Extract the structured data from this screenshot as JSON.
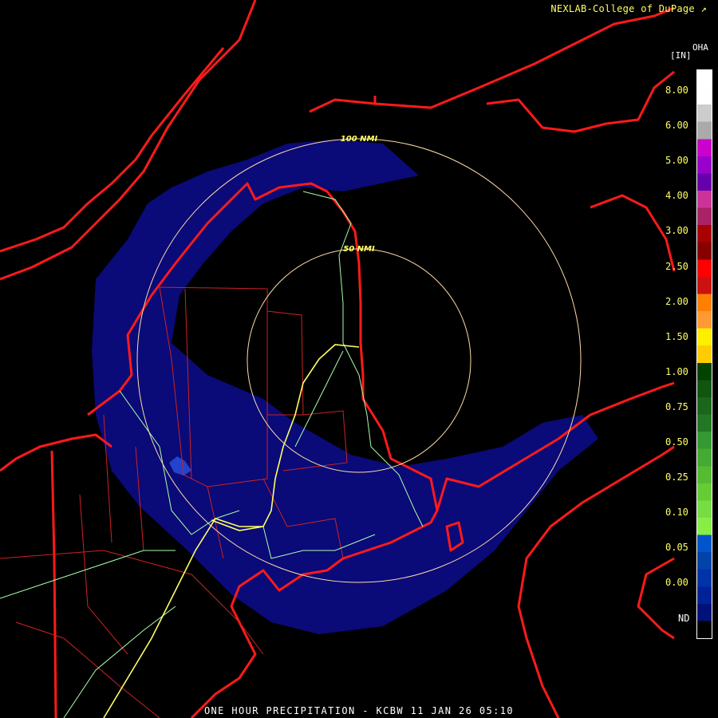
{
  "header": {
    "credit": "NEXLAB-College of DuPage",
    "credit_icon": "external-link-icon"
  },
  "footer": {
    "caption": "ONE HOUR PRECIPITATION - KCBW 11 JAN 26 05:10"
  },
  "legend": {
    "product": "OHA",
    "units": "[IN]",
    "labels": [
      "8.00",
      "6.00",
      "5.00",
      "4.00",
      "3.00",
      "2.50",
      "2.00",
      "1.50",
      "1.00",
      "0.75",
      "0.50",
      "0.25",
      "0.10",
      "0.05",
      "0.00",
      "ND"
    ],
    "colors": [
      "#ffffff",
      "#fefefe",
      "#cccccc",
      "#aaaaaa",
      "#cc00cc",
      "#9900cc",
      "#6600aa",
      "#cc3399",
      "#aa2266",
      "#aa0000",
      "#880000",
      "#ff0000",
      "#cc1111",
      "#ff7f00",
      "#ff9933",
      "#ffee00",
      "#ffcc00",
      "#004400",
      "#115511",
      "#1a661a",
      "#227722",
      "#339933",
      "#44aa33",
      "#55bb33",
      "#66cc33",
      "#77dd44",
      "#88ee44",
      "#0055cc",
      "#0044aa",
      "#0033aa",
      "#002299",
      "#00117a",
      "#000000"
    ]
  },
  "rings": [
    {
      "label": "50 NMI"
    },
    {
      "label": "100 NMI"
    }
  ],
  "colors": {
    "background": "#000000",
    "precip": "#0a0a78",
    "precip_light": "#2244cc",
    "border": "#ff1a1a",
    "county": "#cc2222",
    "highway": "#ffff66",
    "road": "#aaffaa",
    "ring": "#ffdca8"
  }
}
